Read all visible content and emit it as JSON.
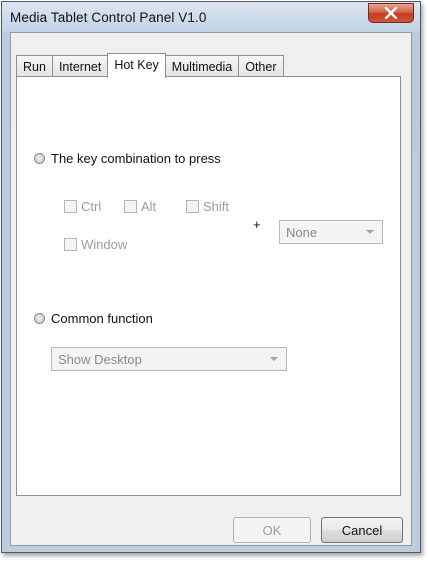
{
  "window": {
    "title": "Media Tablet Control Panel V1.0",
    "close_glyph": "x"
  },
  "tabs": [
    {
      "label": "Run",
      "active": false
    },
    {
      "label": "Internet",
      "active": false
    },
    {
      "label": "Hot Key",
      "active": true
    },
    {
      "label": "Multimedia",
      "active": false
    },
    {
      "label": "Other",
      "active": false
    }
  ],
  "hotkey": {
    "key_combo_label": "The key combination to press",
    "modifiers": {
      "ctrl": "Ctrl",
      "alt": "Alt",
      "shift": "Shift",
      "window": "Window"
    },
    "plus": "+",
    "key_select_value": "None",
    "common_function_label": "Common function",
    "function_select_value": "Show Desktop"
  },
  "buttons": {
    "ok": "OK",
    "cancel": "Cancel"
  },
  "colors": {
    "close_button": "#c23b22",
    "title_bar": "#c2d3e6",
    "disabled_text": "#9c9c9c"
  }
}
